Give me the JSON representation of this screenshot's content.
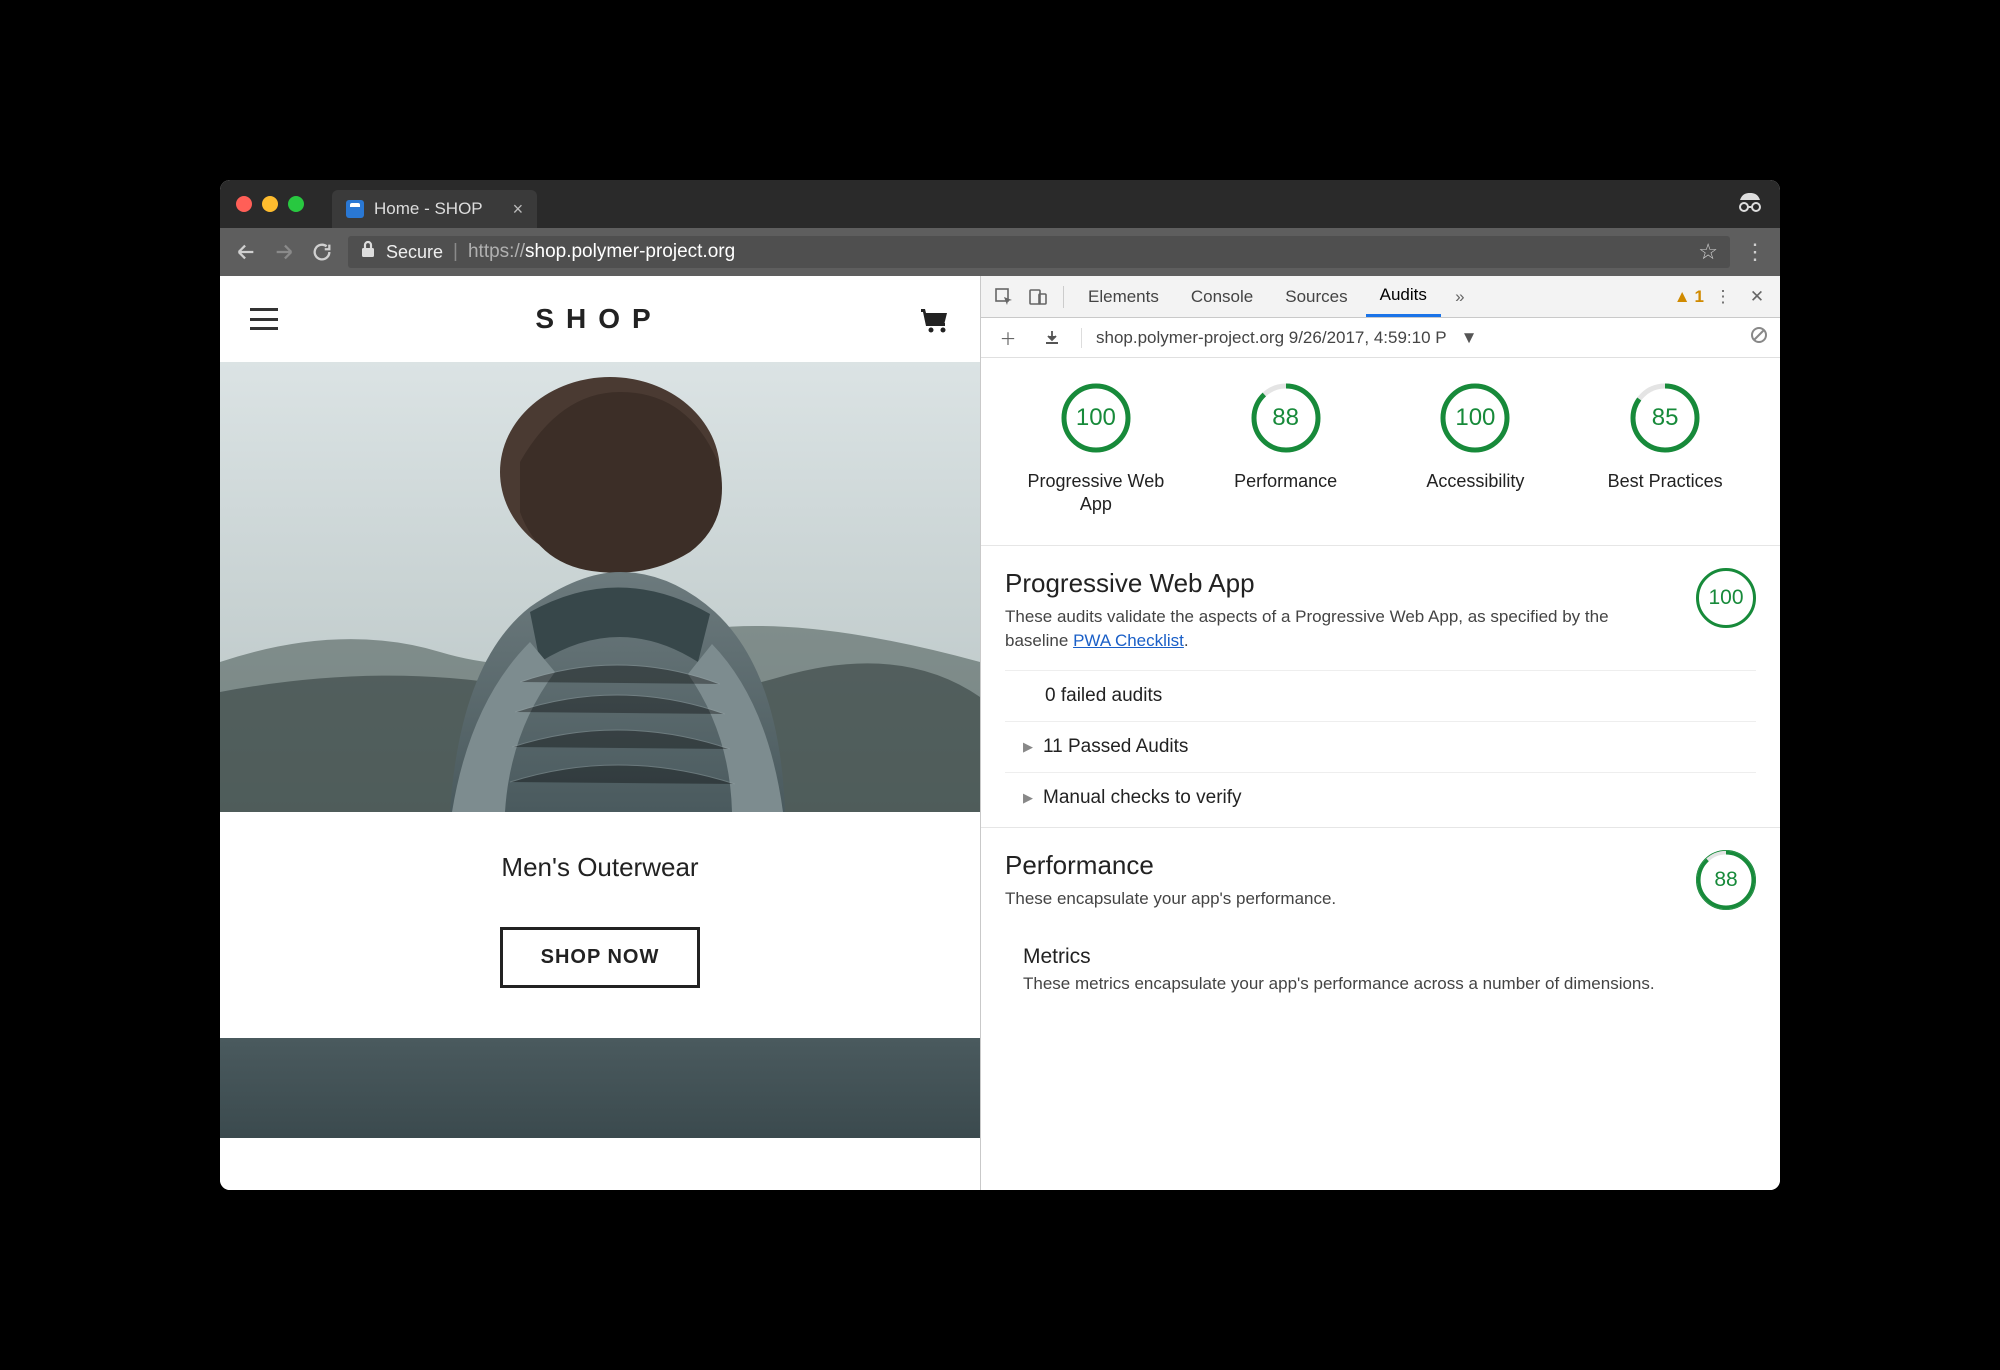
{
  "browser": {
    "tab_title": "Home - SHOP",
    "secure_label": "Secure",
    "url_proto": "https://",
    "url_rest": "shop.polymer-project.org"
  },
  "page": {
    "logo": "SHOP",
    "category": "Men's Outerwear",
    "cta": "SHOP NOW"
  },
  "devtools": {
    "tabs": {
      "elements": "Elements",
      "console": "Console",
      "sources": "Sources",
      "audits": "Audits"
    },
    "warn_count": "1",
    "run_label": "shop.polymer-project.org 9/26/2017, 4:59:10 P",
    "gauges": [
      {
        "score": "100",
        "label": "Progressive Web App",
        "pct": 100
      },
      {
        "score": "88",
        "label": "Performance",
        "pct": 88
      },
      {
        "score": "100",
        "label": "Accessibility",
        "pct": 100
      },
      {
        "score": "85",
        "label": "Best Practices",
        "pct": 85
      }
    ],
    "pwa": {
      "title": "Progressive Web App",
      "desc_a": "These audits validate the aspects of a Progressive Web App, as specified by the baseline ",
      "link": "PWA Checklist",
      "desc_b": ".",
      "score": "100",
      "rows": {
        "failed": "0 failed audits",
        "passed": "11 Passed Audits",
        "manual": "Manual checks to verify"
      }
    },
    "perf": {
      "title": "Performance",
      "desc": "These encapsulate your app's performance.",
      "score": "88",
      "metrics_title": "Metrics",
      "metrics_desc": "These metrics encapsulate your app's performance across a number of dimensions."
    }
  }
}
